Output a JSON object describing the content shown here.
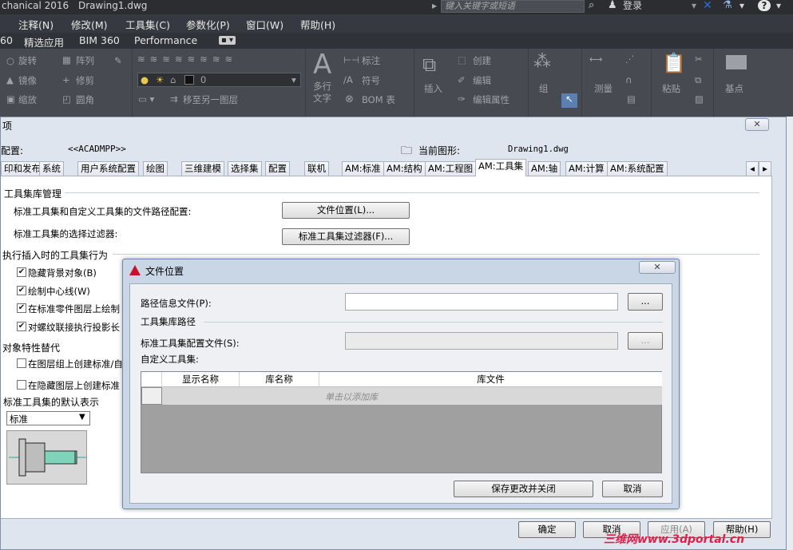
{
  "app": {
    "title": "chanical 2016",
    "drawing": "Drawing1.dwg",
    "search_placeholder": "键入关键字或短语",
    "login": "登录",
    "menu": [
      "注释(N)",
      "修改(M)",
      "工具集(C)",
      "参数化(P)",
      "窗口(W)",
      "帮助(H)"
    ],
    "tabs": [
      "60",
      "精选应用",
      "BIM 360",
      "Performance"
    ]
  },
  "ribbon": {
    "modify": [
      "旋转",
      "阵列",
      "镜像",
      "修剪",
      "缩放",
      "圆角"
    ],
    "layer": {
      "layer_name": "0",
      "move_layer": "移至另一图层"
    },
    "annotation": {
      "text": "多行文字",
      "dimension": "标注",
      "symbol": "符号",
      "bom": "BOM 表"
    },
    "block": {
      "insert": "插入",
      "create": "创建",
      "edit": "编辑",
      "edit_attr": "编辑属性"
    },
    "group": "组",
    "measure": "测量",
    "paste": "粘贴",
    "base": "基点"
  },
  "options_dialog": {
    "title": "项",
    "profile_label": "配置:",
    "profile_value": "<<ACADMPP>>",
    "current_drawing_label": "当前图形:",
    "current_drawing_value": "Drawing1.dwg",
    "tabs": [
      "印和发布",
      "系统",
      "用户系统配置",
      "绘图",
      "三维建模",
      "选择集",
      "配置",
      "联机",
      "AM:标准",
      "AM:结构",
      "AM:工程图",
      "AM:工具集",
      "AM:轴",
      "AM:计算",
      "AM:系统配置"
    ],
    "active_tab": "AM:工具集",
    "toolbox_mgmt": "工具集库管理",
    "path_config_label": "标准工具集和自定义工具集的文件路径配置:",
    "file_location_btn": "文件位置(L)...",
    "filter_label": "标准工具集的选择过滤器:",
    "filter_btn": "标准工具集过滤器(F)...",
    "insert_behavior": "执行插入时的工具集行为",
    "checks": [
      "隐藏背景对象(B)",
      "绘制中心线(W)",
      "在标准零件图层上绘制",
      "对螺纹联接执行投影长"
    ],
    "override": "对象特性替代",
    "override_checks": [
      "在图层组上创建标准/自",
      "在隐藏图层上创建标准"
    ],
    "default_rep": "标准工具集的默认表示",
    "rep_value": "标准",
    "ok": "确定",
    "cancel": "取消",
    "apply": "应用(A)",
    "help": "帮助(H)"
  },
  "file_location_dialog": {
    "title": "文件位置",
    "path_info_label": "路径信息文件(P):",
    "path_info_value": "",
    "browse": "...",
    "lib_path": "工具集库路径",
    "std_config_label": "标准工具集配置文件(S):",
    "custom_label": "自定义工具集:",
    "columns": [
      "显示名称",
      "库名称",
      "库文件"
    ],
    "add_row": "单击以添加库",
    "save_close": "保存更改并关闭",
    "cancel": "取消"
  },
  "watermark": "三维网www.3dportal.cn"
}
